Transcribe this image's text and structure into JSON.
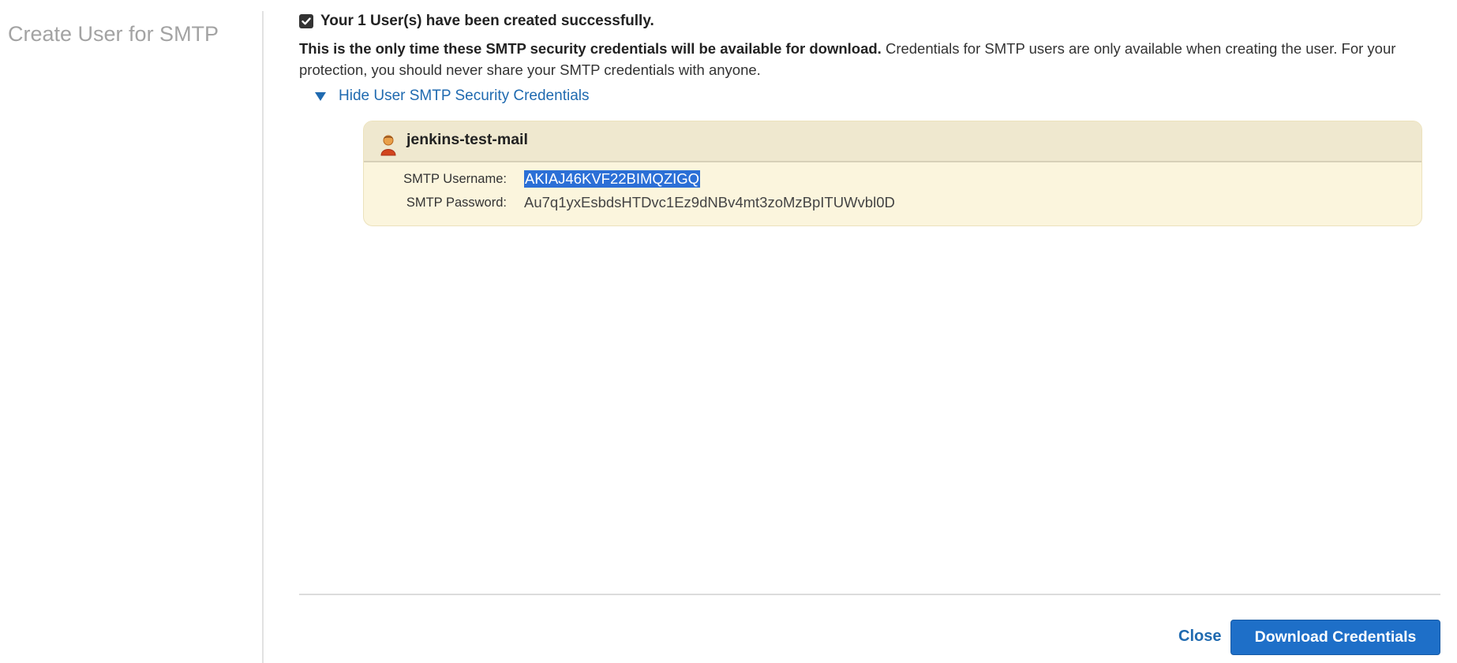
{
  "left_panel": {
    "title": "Create User for SMTP"
  },
  "success": {
    "message": "Your 1 User(s) have been created successfully."
  },
  "info": {
    "bold_text": "This is the only time these SMTP security credentials will be available for download.",
    "rest_text": " Credentials for SMTP users are only available when creating the user. For your protection, you should never share your SMTP credentials with anyone."
  },
  "toggle": {
    "label": "Hide User SMTP Security Credentials"
  },
  "credentials": {
    "user_name": "jenkins-test-mail",
    "username_label": "SMTP Username:",
    "username_value": "AKIAJ46KVF22BIMQZIGQ",
    "password_label": "SMTP Password:",
    "password_value": "Au7q1yxEsbdsHTDvc1Ez9dNBv4mt3zoMzBpITUWvbl0D"
  },
  "footer": {
    "close_label": "Close",
    "download_label": "Download Credentials"
  },
  "colors": {
    "link": "#1f6ab0",
    "primary_button": "#1e6fc8",
    "credential_box": "#fbf5dd",
    "selection": "#2b6fd6"
  },
  "icons": {
    "success": "checkbox-checked-icon",
    "toggle": "caret-down-icon",
    "user": "user-icon"
  }
}
